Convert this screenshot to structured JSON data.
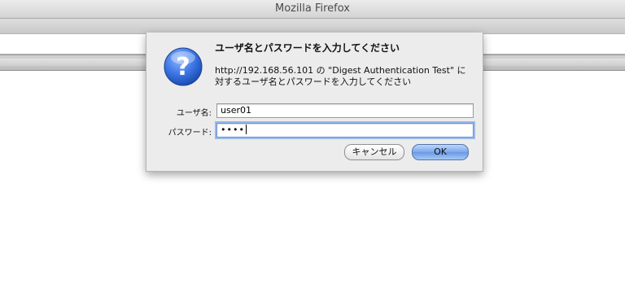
{
  "window": {
    "title": "Mozilla Firefox"
  },
  "dialog": {
    "icon": "question-icon",
    "heading": "ユーザ名とパスワードを入力してください",
    "message_line1": "http://192.168.56.101 の \"Digest Authentication Test\" に",
    "message_line2": "対するユーザ名とパスワードを入力してください",
    "username_label": "ユーザ名:",
    "username_value": "user01",
    "password_label": "パスワード:",
    "password_value": "••••",
    "cancel_label": "キャンセル",
    "ok_label": "OK"
  },
  "colors": {
    "accent": "#6a99e3",
    "focus_ring": "#98b9ec",
    "sheet_bg": "#ececec"
  }
}
